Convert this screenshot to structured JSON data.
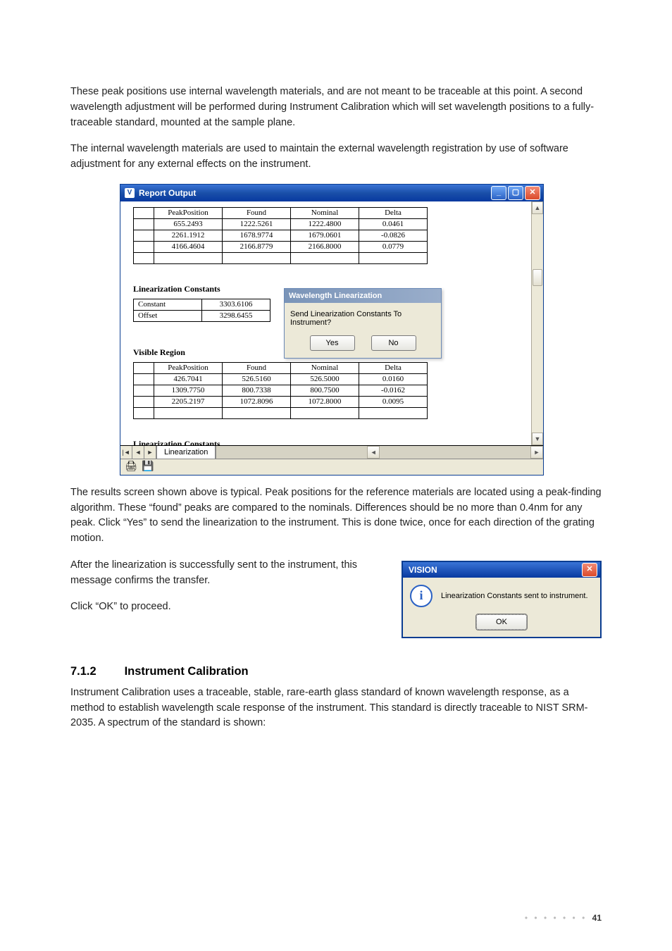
{
  "paragraphs": {
    "p1": "These peak positions use internal wavelength materials, and are not meant to be traceable at this point. A second wavelength adjustment will be performed during Instrument Calibration which will set wavelength positions to a fully-traceable standard, mounted at the sample plane.",
    "p2": "The internal wavelength materials are used to maintain the external wavelength registration by use of software adjustment for any external effects on the instrument.",
    "p3": "The results screen shown above is typical. Peak positions for the reference materials are located using a peak-finding algorithm. These “found” peaks are compared to the nominals. Differences should be no more than 0.4nm for any peak. Click “Yes” to send the linearization to the instrument. This is done twice, once for each direction of the grating motion.",
    "p4": "After the linearization is successfully sent to the instrument, this message confirms the transfer.",
    "p5": "Click “OK” to proceed.",
    "p6": "Instrument Calibration uses a traceable, stable, rare-earth glass standard of known wavelength response, as a method to establish wavelength scale response of the instrument. This standard is directly traceable to NIST SRM-2035. A spectrum of the standard is shown:"
  },
  "report_window": {
    "title": "Report Output",
    "nir_table": {
      "headers": [
        "PeakPosition",
        "Found",
        "Nominal",
        "Delta"
      ],
      "rows": [
        [
          "655.2493",
          "1222.5261",
          "1222.4800",
          "0.0461"
        ],
        [
          "2261.1912",
          "1678.9774",
          "1679.0601",
          "-0.0826"
        ],
        [
          "4166.4604",
          "2166.8779",
          "2166.8000",
          "0.0779"
        ]
      ]
    },
    "lin_const_heading": "Linearization Constants",
    "constants": {
      "labels": [
        "Constant",
        "Offset"
      ],
      "values": [
        "3303.6106",
        "3298.6455"
      ]
    },
    "visible_region_heading": "Visible Region",
    "vis_table": {
      "headers": [
        "PeakPosition",
        "Found",
        "Nominal",
        "Delta"
      ],
      "rows": [
        [
          "426.7041",
          "526.5160",
          "526.5000",
          "0.0160"
        ],
        [
          "1309.7750",
          "800.7338",
          "800.7500",
          "-0.0162"
        ],
        [
          "2205.2197",
          "1072.8096",
          "1072.8000",
          "0.0095"
        ]
      ]
    },
    "lin_const_heading2": "Linearization Constants",
    "sheet_tab": "Linearization"
  },
  "linearization_dialog": {
    "title": "Wavelength Linearization",
    "message": "Send Linearization Constants To Instrument?",
    "yes": "Yes",
    "no": "No"
  },
  "info_dialog": {
    "title": "VISION",
    "message": "Linearization Constants sent to instrument.",
    "ok": "OK"
  },
  "heading": {
    "number": "7.1.2",
    "text": "Instrument Calibration"
  },
  "page_number": "41"
}
